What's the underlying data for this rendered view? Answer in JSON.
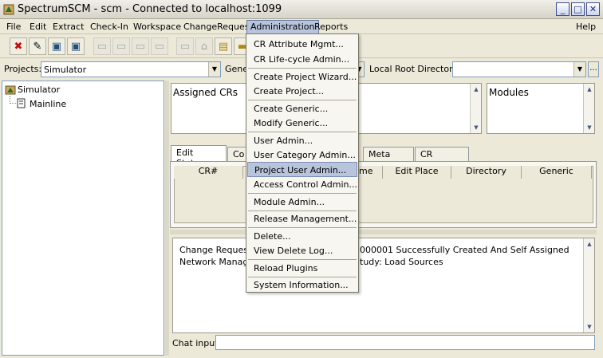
{
  "window": {
    "title": "SpectrumSCM - scm - Connected to localhost:1099"
  },
  "menubar": {
    "items": [
      "File",
      "Edit",
      "Extract",
      "Check-In",
      "Workspace",
      "ChangeRequest",
      "Administration",
      "Reports"
    ],
    "help": "Help"
  },
  "toolbar": {
    "icons": [
      "close-x-icon",
      "edit-document-icon",
      "monitor-icon",
      "monitor-icon",
      "folder-icon",
      "folder-icon",
      "folder-icon",
      "folder-icon",
      "folder-icon",
      "lock-icon",
      "new-file-icon",
      "folder-icon"
    ]
  },
  "projects": {
    "label": "Projects:",
    "value": "Simulator",
    "generic_label_partial": "Gene",
    "local_root_label": "Local Root Directory:",
    "local_root_value": "",
    "browse_label": "..."
  },
  "tree": {
    "root": "Simulator",
    "child": "Mainline"
  },
  "assigned": {
    "title": "Assigned CRs"
  },
  "modules": {
    "title": "Modules"
  },
  "tabs": {
    "items": [
      "Edit Status",
      "Co",
      "Meta Info",
      "CR Search"
    ]
  },
  "edit_table": {
    "columns": [
      "CR#",
      "me",
      "Edit Place",
      "Directory",
      "Generic"
    ]
  },
  "log": {
    "line1_left": "Change Request N",
    "line1_right": "000001 Successfully Created And Self Assigned",
    "line2_left": "Network Manage",
    "line2_right": "tudy: Load Sources"
  },
  "chat": {
    "label": "Chat input:",
    "value": ""
  },
  "admin_menu": {
    "items": [
      {
        "label": "CR Attribute Mgmt...",
        "highlighted": false
      },
      {
        "label": "CR Life-cycle Admin...",
        "highlighted": false
      },
      {
        "label": "Create Project Wizard...",
        "highlighted": false
      },
      {
        "label": "Create Project...",
        "highlighted": false
      },
      {
        "label": "Create Generic...",
        "highlighted": false
      },
      {
        "label": "Modify Generic...",
        "highlighted": false
      },
      {
        "label": "User Admin...",
        "highlighted": false
      },
      {
        "label": "User Category Admin...",
        "highlighted": false
      },
      {
        "label": "Project User Admin...",
        "highlighted": true
      },
      {
        "label": "Access Control Admin...",
        "highlighted": false
      },
      {
        "label": "Module Admin...",
        "highlighted": false
      },
      {
        "label": "Release Management...",
        "highlighted": false
      },
      {
        "label": "Delete...",
        "highlighted": false
      },
      {
        "label": "View Delete Log...",
        "highlighted": false
      },
      {
        "label": "Reload Plugins",
        "highlighted": false
      },
      {
        "label": "System Information...",
        "highlighted": false
      }
    ]
  },
  "colors": {
    "window_bg": "#ece9d8",
    "menu_highlight": "#b8c4dc",
    "field_border": "#7f9db9"
  }
}
